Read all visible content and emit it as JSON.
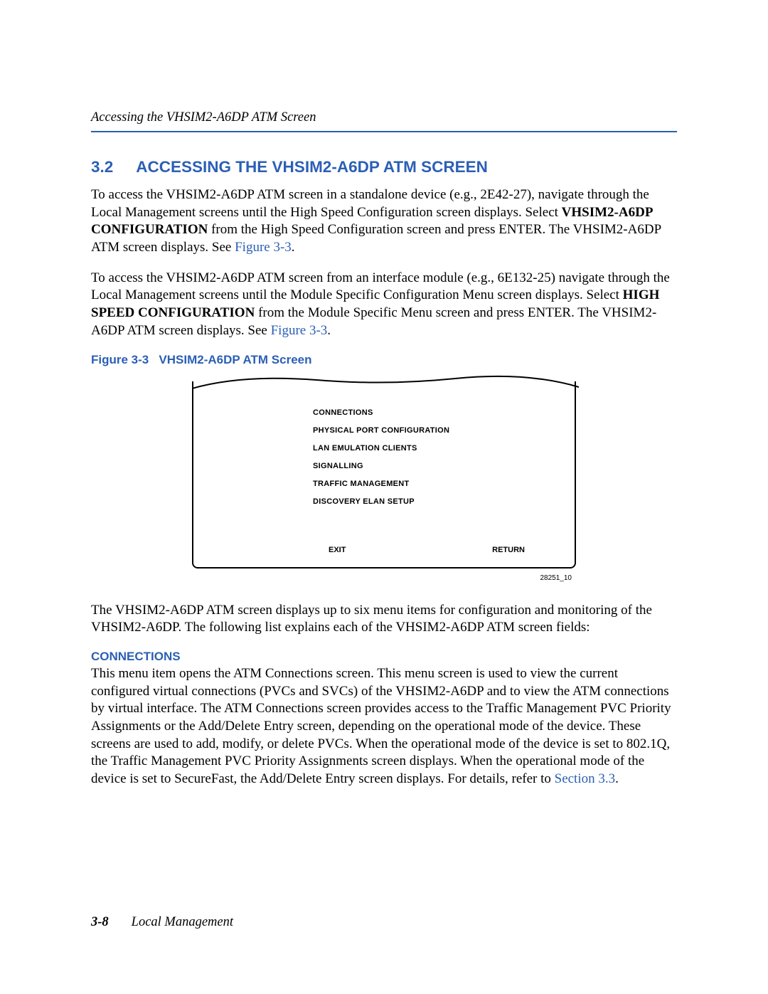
{
  "header": {
    "running_title": "Accessing the VHSIM2-A6DP ATM Screen"
  },
  "section": {
    "number": "3.2",
    "title": "ACCESSING THE VHSIM2-A6DP ATM SCREEN"
  },
  "para1_a": "To access the VHSIM2-A6DP ATM screen in a standalone device (e.g., 2E42-27), navigate through the Local Management screens until the High Speed Configuration screen displays. Select ",
  "para1_bold": "VHSIM2-A6DP CONFIGURATION",
  "para1_b": " from the High Speed Configuration screen and press ENTER. The VHSIM2-A6DP ATM screen displays. See ",
  "para1_link": "Figure 3-3",
  "para1_c": ".",
  "para2_a": "To access the VHSIM2-A6DP ATM screen from an interface module (e.g., 6E132-25) navigate through the Local Management screens until the Module Specific Configuration Menu screen displays. Select ",
  "para2_bold": "HIGH SPEED CONFIGURATION",
  "para2_b": " from the Module Specific Menu screen and press ENTER. The VHSIM2-A6DP ATM screen displays. See ",
  "para2_link": "Figure 3-3",
  "para2_c": ".",
  "figure": {
    "caption_label": "Figure 3-3",
    "caption_title": "VHSIM2-A6DP ATM Screen",
    "menu_items": {
      "i0": "CONNECTIONS",
      "i1": "PHYSICAL PORT CONFIGURATION",
      "i2": "LAN EMULATION CLIENTS",
      "i3": "SIGNALLING",
      "i4": "TRAFFIC MANAGEMENT",
      "i5": "DISCOVERY ELAN SETUP"
    },
    "exit_label": "EXIT",
    "return_label": "RETURN",
    "id": "28251_10"
  },
  "para3": "The VHSIM2-A6DP ATM screen displays up to six menu items for configuration and monitoring of the VHSIM2-A6DP. The following list explains each of the VHSIM2-A6DP ATM screen fields:",
  "connections": {
    "heading": "CONNECTIONS",
    "body_a": "This menu item opens the ATM Connections screen. This menu screen is used to view the current configured virtual connections (PVCs and SVCs) of the VHSIM2-A6DP and to view the ATM connections by virtual interface. The ATM Connections screen provides access to the Traffic Management PVC Priority Assignments or the Add/Delete Entry screen, depending on the operational mode of the device. These screens are used to add, modify, or delete PVCs. When the operational mode of the device is set to 802.1Q, the Traffic Management PVC Priority Assignments screen displays. When the operational mode of the device is set to SecureFast, the Add/Delete Entry screen displays. For details, refer to ",
    "body_link": "Section 3.3",
    "body_b": "."
  },
  "footer": {
    "page_number": "3-8",
    "doc_title": "Local Management"
  }
}
